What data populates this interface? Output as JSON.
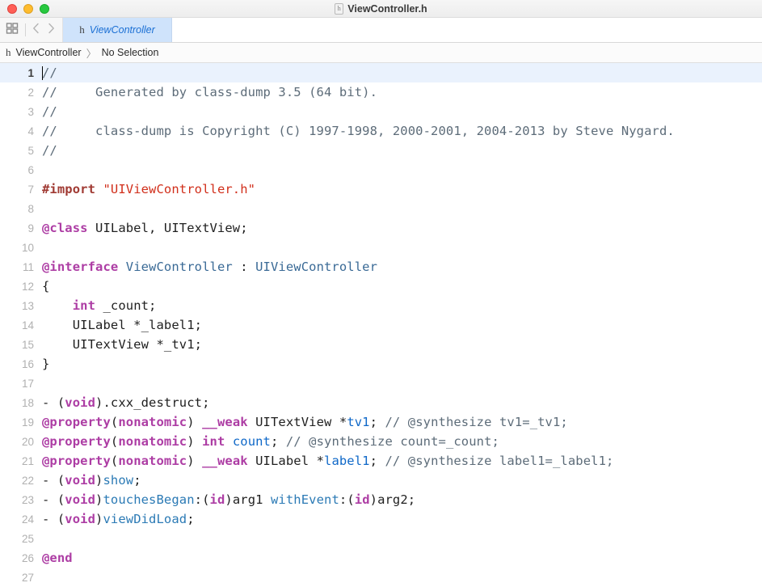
{
  "window": {
    "title": "ViewController.h",
    "file_badge": "h",
    "traffic_lights": [
      {
        "name": "close",
        "color": "#ff5f57"
      },
      {
        "name": "minimize",
        "color": "#febc2e"
      },
      {
        "name": "zoom",
        "color": "#28c840"
      }
    ]
  },
  "toolbar": {
    "grid_icon": "grid-icon",
    "back_label": "‹",
    "forward_label": "›"
  },
  "tab": {
    "badge": "h",
    "label": "ViewController"
  },
  "jumpbar": {
    "badge": "h",
    "file": "ViewController",
    "separator": "〉",
    "selection": "No Selection"
  },
  "editor": {
    "current_line": 1,
    "lines": [
      {
        "n": 1,
        "tokens": [
          {
            "t": "caret",
            "v": ""
          },
          {
            "t": "comment",
            "v": "//"
          }
        ]
      },
      {
        "n": 2,
        "tokens": [
          {
            "t": "comment",
            "v": "//     Generated by class-dump 3.5 (64 bit)."
          }
        ]
      },
      {
        "n": 3,
        "tokens": [
          {
            "t": "comment",
            "v": "//"
          }
        ]
      },
      {
        "n": 4,
        "tokens": [
          {
            "t": "comment",
            "v": "//     class-dump is Copyright (C) 1997-1998, 2000-2001, 2004-2013 by Steve Nygard."
          }
        ]
      },
      {
        "n": 5,
        "tokens": [
          {
            "t": "comment",
            "v": "//"
          }
        ]
      },
      {
        "n": 6,
        "tokens": []
      },
      {
        "n": 7,
        "tokens": [
          {
            "t": "pre",
            "v": "#import"
          },
          {
            "t": "plain",
            "v": " "
          },
          {
            "t": "str",
            "v": "\"UIViewController.h\""
          }
        ]
      },
      {
        "n": 8,
        "tokens": []
      },
      {
        "n": 9,
        "tokens": [
          {
            "t": "kw",
            "v": "@class"
          },
          {
            "t": "plain",
            "v": " UILabel, UITextView;"
          }
        ]
      },
      {
        "n": 10,
        "tokens": []
      },
      {
        "n": 11,
        "tokens": [
          {
            "t": "kw",
            "v": "@interface"
          },
          {
            "t": "plain",
            "v": " "
          },
          {
            "t": "type",
            "v": "ViewController"
          },
          {
            "t": "plain",
            "v": " : "
          },
          {
            "t": "type",
            "v": "UIViewController"
          }
        ]
      },
      {
        "n": 12,
        "tokens": [
          {
            "t": "plain",
            "v": "{"
          }
        ]
      },
      {
        "n": 13,
        "tokens": [
          {
            "t": "plain",
            "v": "    "
          },
          {
            "t": "kw",
            "v": "int"
          },
          {
            "t": "plain",
            "v": " _count;"
          }
        ]
      },
      {
        "n": 14,
        "tokens": [
          {
            "t": "plain",
            "v": "    UILabel *_label1;"
          }
        ]
      },
      {
        "n": 15,
        "tokens": [
          {
            "t": "plain",
            "v": "    UITextView *_tv1;"
          }
        ]
      },
      {
        "n": 16,
        "tokens": [
          {
            "t": "plain",
            "v": "}"
          }
        ]
      },
      {
        "n": 17,
        "tokens": []
      },
      {
        "n": 18,
        "tokens": [
          {
            "t": "plain",
            "v": "- ("
          },
          {
            "t": "kw",
            "v": "void"
          },
          {
            "t": "plain",
            "v": ").cxx_destruct;"
          }
        ]
      },
      {
        "n": 19,
        "tokens": [
          {
            "t": "kw",
            "v": "@property"
          },
          {
            "t": "plain",
            "v": "("
          },
          {
            "t": "kw",
            "v": "nonatomic"
          },
          {
            "t": "plain",
            "v": ") "
          },
          {
            "t": "kw",
            "v": "__weak"
          },
          {
            "t": "plain",
            "v": " UITextView *"
          },
          {
            "t": "prop",
            "v": "tv1"
          },
          {
            "t": "plain",
            "v": "; "
          },
          {
            "t": "comment",
            "v": "// @synthesize tv1=_tv1;"
          }
        ]
      },
      {
        "n": 20,
        "tokens": [
          {
            "t": "kw",
            "v": "@property"
          },
          {
            "t": "plain",
            "v": "("
          },
          {
            "t": "kw",
            "v": "nonatomic"
          },
          {
            "t": "plain",
            "v": ") "
          },
          {
            "t": "kw",
            "v": "int"
          },
          {
            "t": "plain",
            "v": " "
          },
          {
            "t": "prop",
            "v": "count"
          },
          {
            "t": "plain",
            "v": "; "
          },
          {
            "t": "comment",
            "v": "// @synthesize count=_count;"
          }
        ]
      },
      {
        "n": 21,
        "tokens": [
          {
            "t": "kw",
            "v": "@property"
          },
          {
            "t": "plain",
            "v": "("
          },
          {
            "t": "kw",
            "v": "nonatomic"
          },
          {
            "t": "plain",
            "v": ") "
          },
          {
            "t": "kw",
            "v": "__weak"
          },
          {
            "t": "plain",
            "v": " UILabel *"
          },
          {
            "t": "prop",
            "v": "label1"
          },
          {
            "t": "plain",
            "v": "; "
          },
          {
            "t": "comment",
            "v": "// @synthesize label1=_label1;"
          }
        ]
      },
      {
        "n": 22,
        "tokens": [
          {
            "t": "plain",
            "v": "- ("
          },
          {
            "t": "kw",
            "v": "void"
          },
          {
            "t": "plain",
            "v": ")"
          },
          {
            "t": "method",
            "v": "show"
          },
          {
            "t": "plain",
            "v": ";"
          }
        ]
      },
      {
        "n": 23,
        "tokens": [
          {
            "t": "plain",
            "v": "- ("
          },
          {
            "t": "kw",
            "v": "void"
          },
          {
            "t": "plain",
            "v": ")"
          },
          {
            "t": "method",
            "v": "touchesBegan"
          },
          {
            "t": "plain",
            "v": ":("
          },
          {
            "t": "kw",
            "v": "id"
          },
          {
            "t": "plain",
            "v": ")arg1 "
          },
          {
            "t": "method",
            "v": "withEvent"
          },
          {
            "t": "plain",
            "v": ":("
          },
          {
            "t": "kw",
            "v": "id"
          },
          {
            "t": "plain",
            "v": ")arg2;"
          }
        ]
      },
      {
        "n": 24,
        "tokens": [
          {
            "t": "plain",
            "v": "- ("
          },
          {
            "t": "kw",
            "v": "void"
          },
          {
            "t": "plain",
            "v": ")"
          },
          {
            "t": "method",
            "v": "viewDidLoad"
          },
          {
            "t": "plain",
            "v": ";"
          }
        ]
      },
      {
        "n": 25,
        "tokens": []
      },
      {
        "n": 26,
        "tokens": [
          {
            "t": "kw",
            "v": "@end"
          }
        ]
      },
      {
        "n": 27,
        "tokens": []
      }
    ]
  },
  "colors": {
    "comment": "#5d6c79",
    "keyword": "#ad3da4",
    "preprocessor": "#a03a33",
    "string": "#d12f1b",
    "type": "#3a6a96",
    "property": "#0f68c8",
    "method": "#2b7ab5",
    "current_line_bg": "#eaf2fd",
    "tab_active_bg": "#cfe3fb",
    "tab_label": "#1a6fd4"
  }
}
